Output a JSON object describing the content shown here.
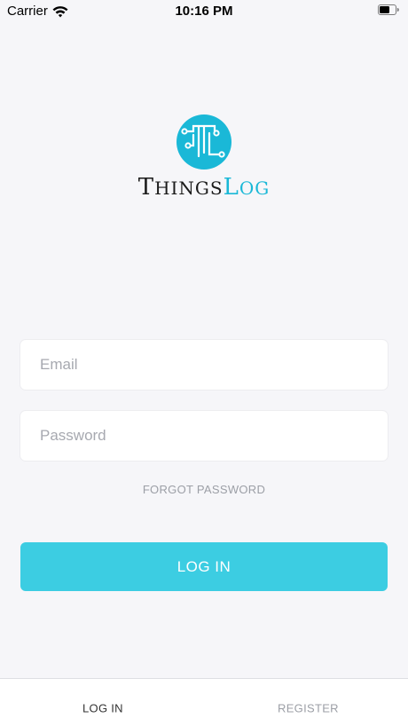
{
  "status_bar": {
    "carrier": "Carrier",
    "time": "10:16 PM"
  },
  "logo": {
    "brand_T": "T",
    "brand_hings": "HINGS",
    "brand_L": "L",
    "brand_og": "OG",
    "brand_color": "#1ab8d7"
  },
  "form": {
    "email_placeholder": "Email",
    "password_placeholder": "Password",
    "forgot_label": "FORGOT PASSWORD",
    "login_label": "LOG IN",
    "button_color": "#3ccde2"
  },
  "tabs": [
    {
      "label": "LOG IN",
      "active": true
    },
    {
      "label": "REGISTER",
      "active": false
    }
  ]
}
